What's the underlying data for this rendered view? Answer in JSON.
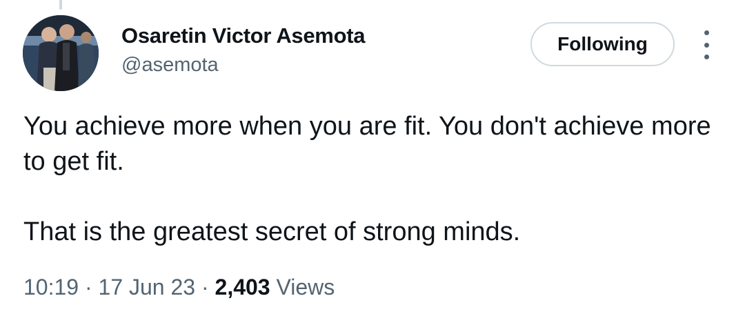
{
  "author": {
    "display_name": "Osaretin Victor Asemota",
    "handle": "@asemota"
  },
  "follow_button": {
    "label": "Following"
  },
  "more_menu": {
    "icon": "more-vertical-icon"
  },
  "tweet": {
    "paragraphs": [
      "You achieve more when you are fit. You don't achieve more to get fit.",
      "That is the greatest secret of strong minds."
    ]
  },
  "meta": {
    "time": "10:19",
    "separator": "·",
    "date": "17 Jun 23",
    "views_count": "2,403",
    "views_label": "Views"
  },
  "colors": {
    "text_primary": "#0f1419",
    "text_secondary": "#536471",
    "border": "#cfd9de"
  }
}
